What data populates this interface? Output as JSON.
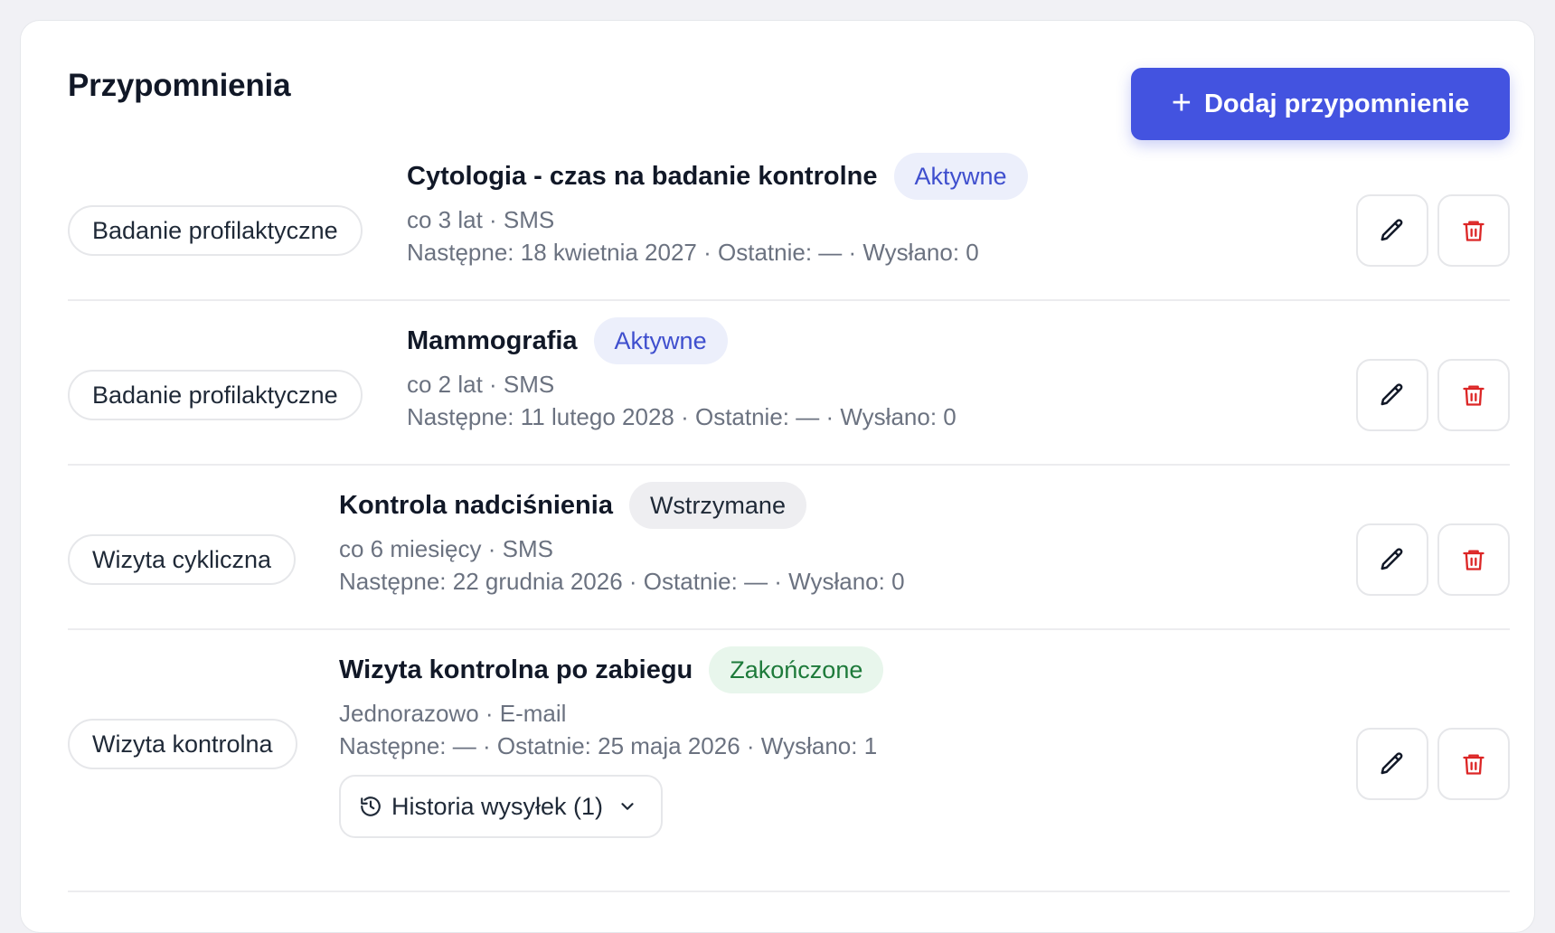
{
  "page": {
    "title": "Przypomnienia",
    "add_button_label": "Dodaj przypomnienie"
  },
  "colors": {
    "accent": "#4353e0",
    "active_badge_bg": "#eceffb",
    "active_badge_text": "#3f4fce",
    "paused_badge_bg": "#eeeef1",
    "done_badge_bg": "#e8f6ec",
    "done_badge_text": "#1d7a3a",
    "delete_icon": "#dc2626"
  },
  "reminders": [
    {
      "category": "Badanie profilaktyczne",
      "title": "Cytologia - czas na badanie kontrolne",
      "status": "Aktywne",
      "frequency": "co 3 lat · SMS",
      "details": "Następne: 18 kwietnia 2027 · Ostatnie: — · Wysłano: 0"
    },
    {
      "category": "Badanie profilaktyczne",
      "title": "Mammografia",
      "status": "Aktywne",
      "frequency": "co 2 lat · SMS",
      "details": "Następne: 11 lutego 2028 · Ostatnie: — · Wysłano: 0"
    },
    {
      "category": "Wizyta cykliczna",
      "title": "Kontrola nadciśnienia",
      "status": "Wstrzymane",
      "frequency": "co 6 miesięcy · SMS",
      "details": "Następne: 22 grudnia 2026 · Ostatnie: — · Wysłano: 0"
    },
    {
      "category": "Wizyta kontrolna",
      "title": "Wizyta kontrolna po zabiegu",
      "status": "Zakończone",
      "frequency": "Jednorazowo · E-mail",
      "details": "Następne: — · Ostatnie: 25 maja 2026 · Wysłano: 1",
      "history_label": "Historia wysyłek (1)"
    }
  ],
  "icons": {
    "add": "plus-icon",
    "edit": "pencil-icon",
    "delete": "trash-icon",
    "history": "history-icon",
    "expand": "chevron-down-icon"
  }
}
